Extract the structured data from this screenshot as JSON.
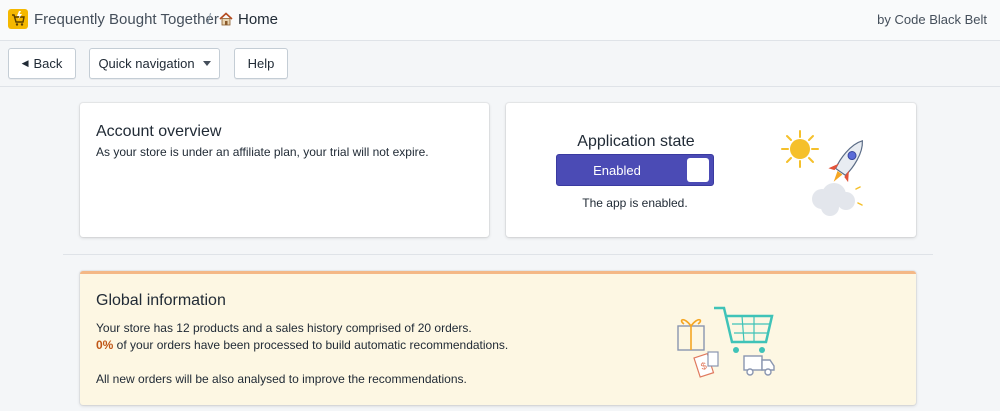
{
  "header": {
    "app_name": "Frequently Bought Together",
    "separator": "/",
    "page": "Home",
    "byline": "by Code Black Belt"
  },
  "toolbar": {
    "back_label": "Back",
    "quick_nav_label": "Quick navigation",
    "help_label": "Help"
  },
  "account": {
    "title": "Account overview",
    "description": "As your store is under an affiliate plan, your trial will not expire."
  },
  "app_state": {
    "title": "Application state",
    "toggle_label": "Enabled",
    "status_text": "The app is enabled."
  },
  "global": {
    "title": "Global information",
    "line1": "Your store has 12 products and a sales history comprised of 20 orders.",
    "percent": "0%",
    "line2": " of your orders have been processed to build automatic recommendations.",
    "line3": "All new orders will be also analysed to improve the recommendations."
  },
  "colors": {
    "toggle_bg": "#4b4bb5",
    "highlight": "#c05717",
    "banner_bg": "#fdf7e3",
    "banner_accent": "#f4b886"
  }
}
